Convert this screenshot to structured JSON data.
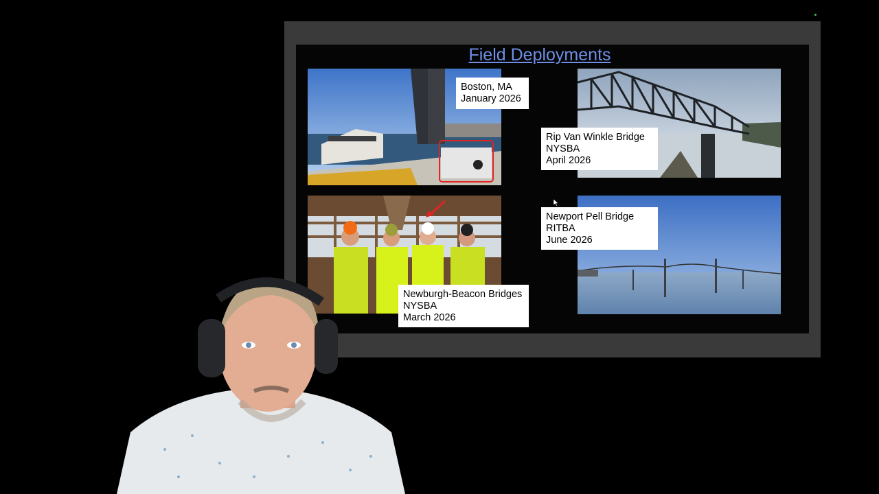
{
  "slide": {
    "title": "Field Deployments",
    "deployments": [
      {
        "id": "boston",
        "lines": [
          "Boston, MA",
          "January 2026"
        ]
      },
      {
        "id": "rip-van-winkle",
        "lines": [
          "Rip Van Winkle Bridge",
          "NYSBA",
          "April 2026"
        ]
      },
      {
        "id": "newburgh-beacon",
        "lines": [
          "Newburgh-Beacon Bridges",
          "NYSBA",
          "March 2026"
        ]
      },
      {
        "id": "newport-pell",
        "lines": [
          "Newport Pell Bridge",
          "RITBA",
          "June 2026"
        ]
      }
    ]
  },
  "colors": {
    "title": "#6f8fe6",
    "frame": "#3a3a3a",
    "highlight": "#e02424",
    "safety_vest": "#d7f21b"
  },
  "icons": {
    "cursor": "cursor-icon",
    "status": "status-dot-icon"
  }
}
